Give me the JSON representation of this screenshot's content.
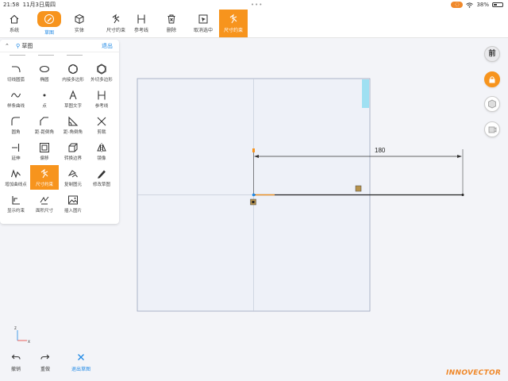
{
  "status": {
    "time": "21:58",
    "date": "11月3日周四",
    "dots": "•••",
    "pill": "◌",
    "battery": "38%"
  },
  "toolbar": {
    "items": [
      {
        "label": "系统",
        "icon": "home-icon"
      },
      {
        "label": "草图",
        "icon": "pencil-icon"
      },
      {
        "label": "实体",
        "icon": "cube-icon"
      },
      {
        "label": "尺寸约束",
        "icon": "dimension-icon"
      },
      {
        "label": "参考线",
        "icon": "reference-line-icon"
      },
      {
        "label": "删除",
        "icon": "trash-icon"
      },
      {
        "label": "取消选中",
        "icon": "deselect-icon"
      },
      {
        "label": "尺寸约束",
        "icon": "dimension-icon"
      }
    ]
  },
  "panel": {
    "title": "草图",
    "exit": "退出",
    "tools": [
      {
        "label": "切线圆弧",
        "icon": "tangent-arc-icon"
      },
      {
        "label": "椭圆",
        "icon": "ellipse-icon"
      },
      {
        "label": "内接多边形",
        "icon": "inscribed-polygon-icon"
      },
      {
        "label": "外切多边形",
        "icon": "circumscribed-polygon-icon"
      },
      {
        "label": "样条曲线",
        "icon": "spline-icon"
      },
      {
        "label": "点",
        "icon": "point-icon"
      },
      {
        "label": "草图文字",
        "icon": "text-icon"
      },
      {
        "label": "参考线",
        "icon": "reference-line-icon"
      },
      {
        "label": "圆角",
        "icon": "fillet-icon"
      },
      {
        "label": "距-距倒角",
        "icon": "chamfer-dd-icon"
      },
      {
        "label": "距-角倒角",
        "icon": "chamfer-da-icon"
      },
      {
        "label": "剪裁",
        "icon": "trim-icon"
      },
      {
        "label": "延伸",
        "icon": "extend-icon"
      },
      {
        "label": "偏移",
        "icon": "offset-icon"
      },
      {
        "label": "转换边界",
        "icon": "convert-edge-icon"
      },
      {
        "label": "镜像",
        "icon": "mirror-icon"
      },
      {
        "label": "增加曲线点",
        "icon": "add-curve-point-icon"
      },
      {
        "label": "尺寸约束",
        "icon": "dimension-icon"
      },
      {
        "label": "复制图元",
        "icon": "copy-entity-icon"
      },
      {
        "label": "修改草图",
        "icon": "edit-sketch-icon"
      },
      {
        "label": "显示约束",
        "icon": "show-constraint-icon"
      },
      {
        "label": "面积尺寸",
        "icon": "area-dimension-icon"
      },
      {
        "label": "插入图片",
        "icon": "insert-image-icon"
      }
    ]
  },
  "canvas": {
    "dimension": "180",
    "axis_x": "x",
    "axis_z": "z"
  },
  "side": {
    "front": "前"
  },
  "bottom": {
    "undo": "撤销",
    "redo": "重做",
    "exit": "退出草图"
  },
  "brand": {
    "logo": "INNOVECTOR"
  },
  "colors": {
    "accent": "#f7941d",
    "link": "#1e88e5"
  }
}
